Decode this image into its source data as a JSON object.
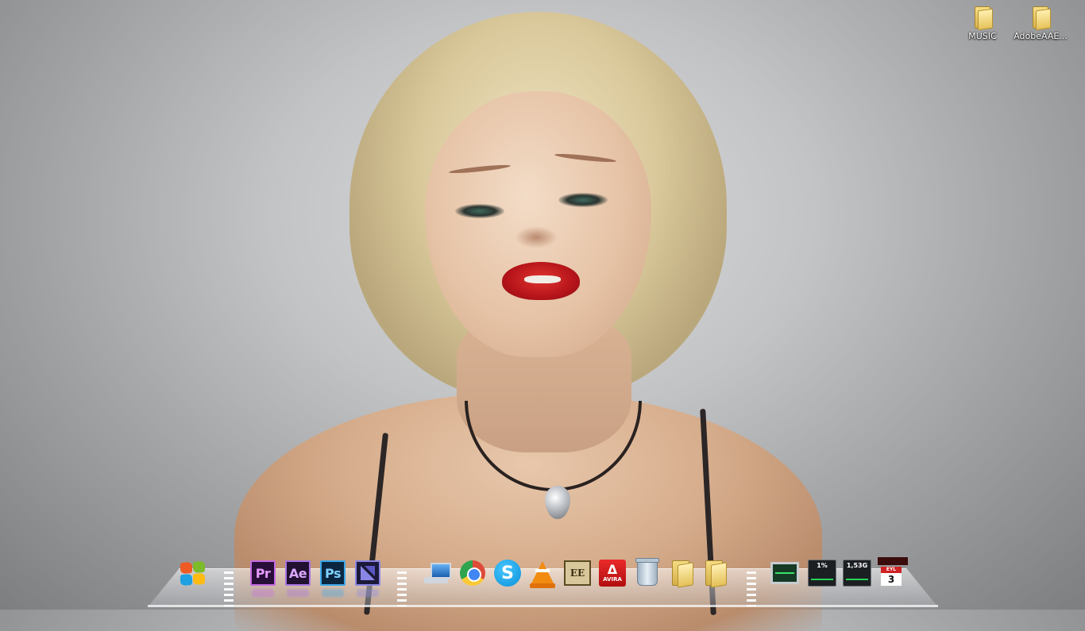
{
  "desktop": {
    "icons": [
      {
        "label": "MUSIC",
        "icon": "folder-icon"
      },
      {
        "label": "AdobeAAE...",
        "icon": "folder-icon"
      }
    ]
  },
  "dock": {
    "items": [
      {
        "name": "windows-start",
        "icon": "windows-logo-icon"
      },
      {
        "name": "premiere",
        "icon": "adobe-premiere-icon",
        "label": "Pr"
      },
      {
        "name": "after-effects",
        "icon": "adobe-after-effects-icon",
        "label": "Ae"
      },
      {
        "name": "photoshop",
        "icon": "adobe-photoshop-icon",
        "label": "Ps"
      },
      {
        "name": "media-encoder",
        "icon": "adobe-media-encoder-icon"
      },
      {
        "name": "network",
        "icon": "network-computer-icon"
      },
      {
        "name": "chrome",
        "icon": "chrome-icon"
      },
      {
        "name": "skype",
        "icon": "skype-icon",
        "label": "S"
      },
      {
        "name": "vlc",
        "icon": "vlc-cone-icon"
      },
      {
        "name": "gold-app",
        "icon": "gold-emblem-icon",
        "label": "EE"
      },
      {
        "name": "avira",
        "icon": "avira-icon",
        "mark": "Δ",
        "label": "AVIRA"
      },
      {
        "name": "recycle-bin",
        "icon": "trash-icon"
      },
      {
        "name": "folder-1",
        "icon": "folder-icon"
      },
      {
        "name": "folder-2",
        "icon": "folder-icon"
      },
      {
        "name": "system-monitor",
        "icon": "monitor-icon"
      },
      {
        "name": "cpu-meter",
        "icon": "cpu-meter-icon",
        "value": "1%"
      },
      {
        "name": "ram-meter",
        "icon": "ram-meter-icon",
        "value": "1,53G"
      },
      {
        "name": "calendar",
        "icon": "calendar-icon",
        "month": "EYL",
        "day": "3"
      }
    ]
  },
  "colors": {
    "background": "#c3c4c6",
    "dock_glass": "#e1e4e8",
    "lips": "#b5141a"
  }
}
